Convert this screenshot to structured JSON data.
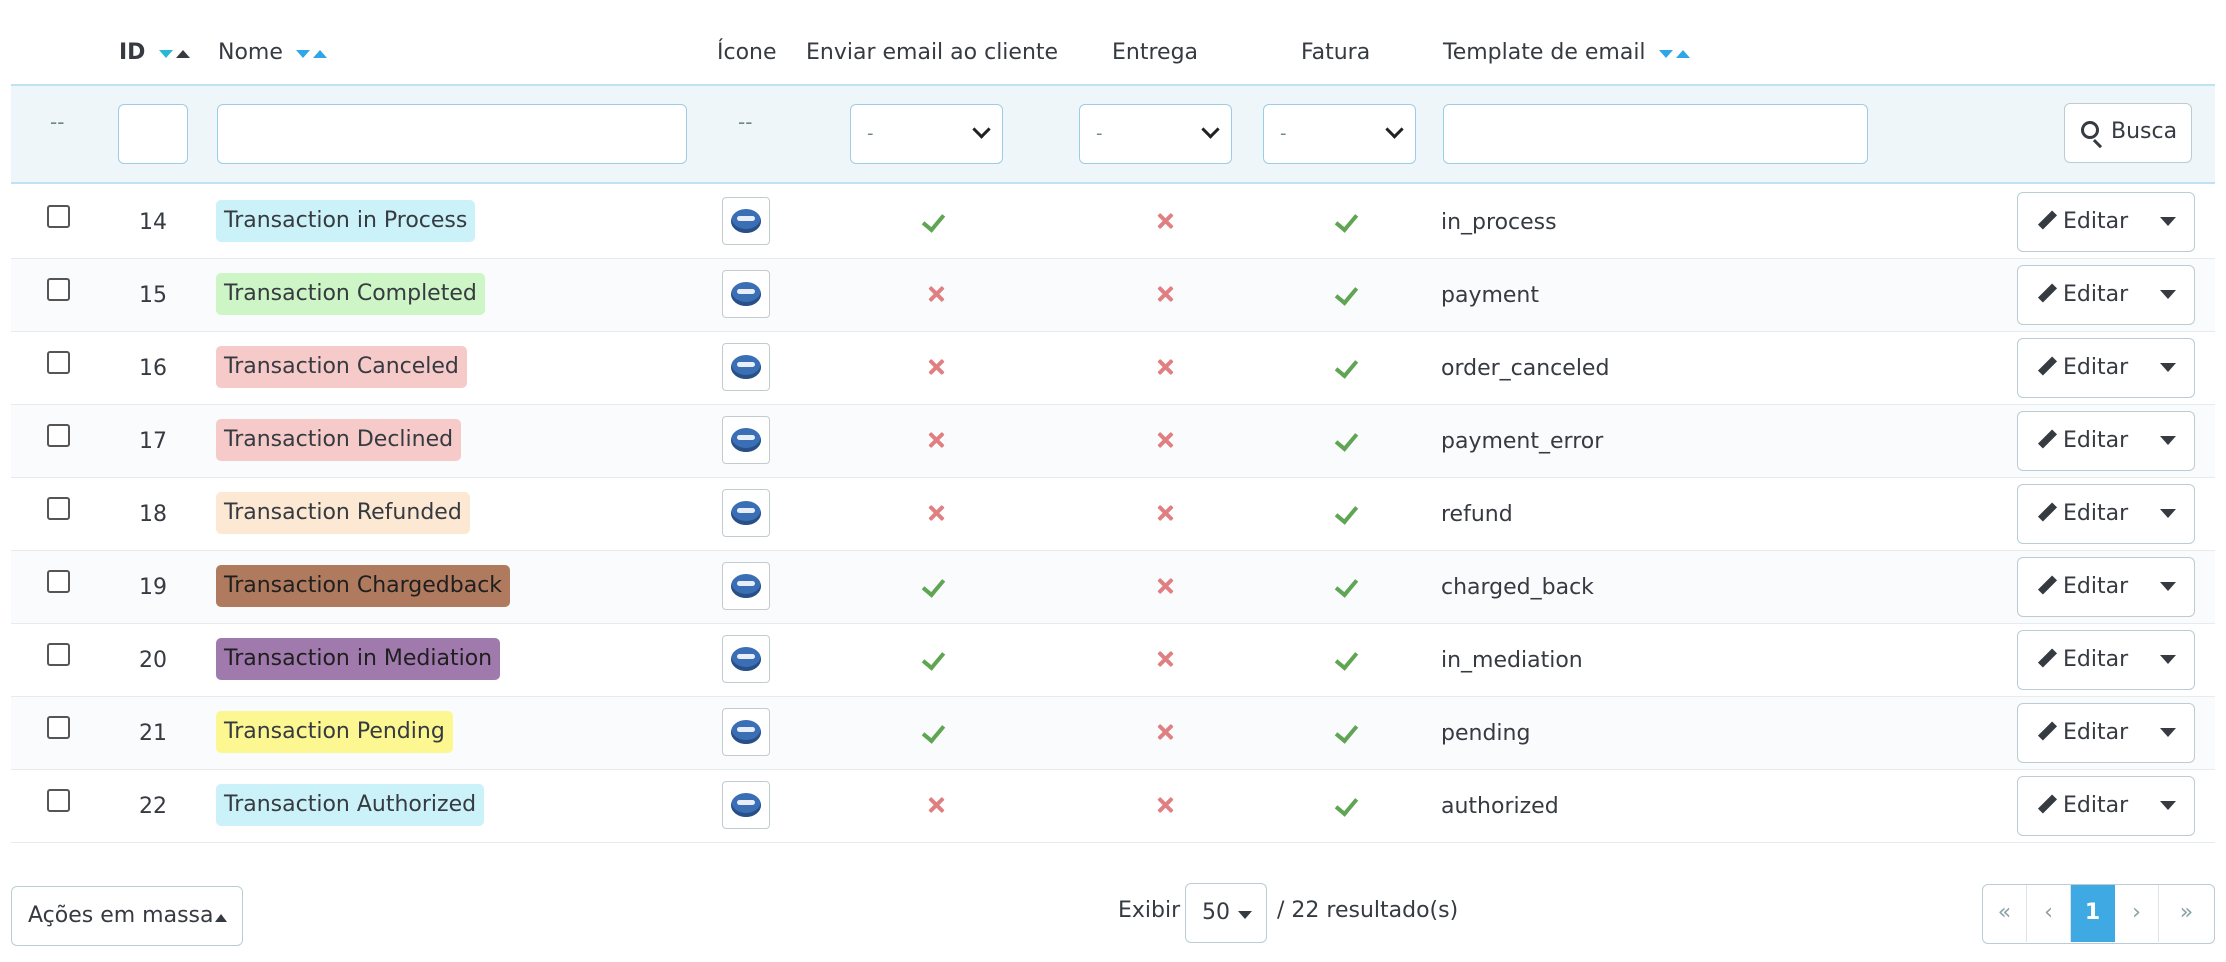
{
  "columns": {
    "id": "ID",
    "nome": "Nome",
    "icone": "Ícone",
    "enviar_email": "Enviar email ao cliente",
    "entrega": "Entrega",
    "fatura": "Fatura",
    "template": "Template de email"
  },
  "filters": {
    "dash_select": "--",
    "dash_icon": "--",
    "enviar_email_value": "-",
    "entrega_value": "-",
    "fatura_value": "-",
    "search_label": "Busca"
  },
  "rows": [
    {
      "id": "14",
      "name": "Transaction in Process",
      "color": "#cbf2f8",
      "text_color": "#363a41",
      "send_email": true,
      "delivery": false,
      "invoice": true,
      "template": "in_process"
    },
    {
      "id": "15",
      "name": "Transaction Completed",
      "color": "#cdf5c5",
      "text_color": "#363a41",
      "send_email": false,
      "delivery": false,
      "invoice": true,
      "template": "payment"
    },
    {
      "id": "16",
      "name": "Transaction Canceled",
      "color": "#f6cac9",
      "text_color": "#363a41",
      "send_email": false,
      "delivery": false,
      "invoice": true,
      "template": "order_canceled"
    },
    {
      "id": "17",
      "name": "Transaction Declined",
      "color": "#f6cac9",
      "text_color": "#363a41",
      "send_email": false,
      "delivery": false,
      "invoice": true,
      "template": "payment_error"
    },
    {
      "id": "18",
      "name": "Transaction Refunded",
      "color": "#fce8d3",
      "text_color": "#363a41",
      "send_email": false,
      "delivery": false,
      "invoice": true,
      "template": "refund"
    },
    {
      "id": "19",
      "name": "Transaction Chargedback",
      "color": "#b07a5f",
      "text_color": "#1f1f1f",
      "send_email": true,
      "delivery": false,
      "invoice": true,
      "template": "charged_back"
    },
    {
      "id": "20",
      "name": "Transaction in Mediation",
      "color": "#a079ad",
      "text_color": "#1f1f1f",
      "send_email": true,
      "delivery": false,
      "invoice": true,
      "template": "in_mediation"
    },
    {
      "id": "21",
      "name": "Transaction Pending",
      "color": "#fdf792",
      "text_color": "#363a41",
      "send_email": true,
      "delivery": false,
      "invoice": true,
      "template": "pending"
    },
    {
      "id": "22",
      "name": "Transaction Authorized",
      "color": "#cbf2f8",
      "text_color": "#363a41",
      "send_email": false,
      "delivery": false,
      "invoice": true,
      "template": "authorized"
    }
  ],
  "row_actions": {
    "edit_label": "Editar"
  },
  "footer": {
    "bulk_label": "Ações em massa",
    "show_label": "Exibir",
    "per_page": "50",
    "results": "/ 22 resultado(s)",
    "pagination": {
      "first": "«",
      "prev": "‹",
      "current": "1",
      "next": "›",
      "last": "»"
    }
  },
  "colors": {
    "accent": "#25b9d7",
    "success": "#5fa554",
    "danger": "#e07e82",
    "active_page": "#3ea9e3"
  }
}
